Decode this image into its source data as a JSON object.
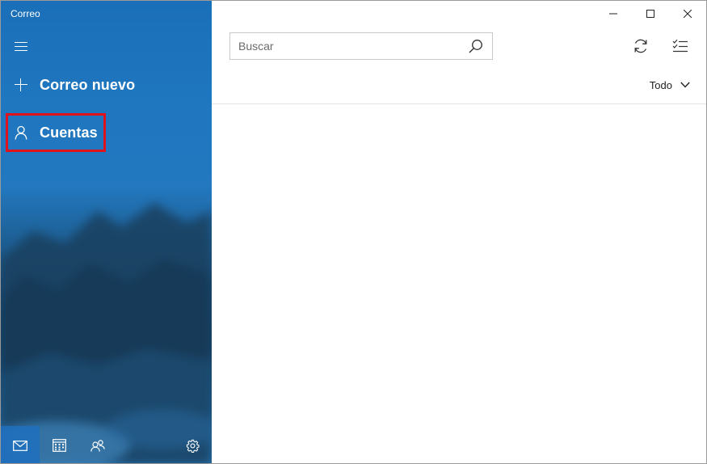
{
  "window": {
    "title": "Correo"
  },
  "sidebar": {
    "menu_icon": "hamburger-icon",
    "new_mail": {
      "label": "Correo nuevo",
      "icon": "plus-icon"
    },
    "accounts": {
      "label": "Cuentas",
      "icon": "person-icon",
      "highlight_color": "#e0121b"
    },
    "bottom": [
      {
        "icon": "mail-icon",
        "active": true
      },
      {
        "icon": "calendar-icon",
        "active": false
      },
      {
        "icon": "people-icon",
        "active": false
      },
      {
        "icon": "gear-icon",
        "active": false
      }
    ]
  },
  "main": {
    "search": {
      "placeholder": "Buscar",
      "value": "",
      "icon": "search-icon"
    },
    "toolbar": {
      "sync_icon": "sync-icon",
      "select_icon": "select-mode-icon"
    },
    "filter": {
      "label": "Todo",
      "icon": "chevron-down-icon"
    }
  },
  "title_controls": [
    "minimize-icon",
    "maximize-icon",
    "close-icon"
  ],
  "colors": {
    "sidebar_top": "#1a6fb8",
    "accent": "#1e6ebe",
    "highlight": "#e0121b"
  }
}
